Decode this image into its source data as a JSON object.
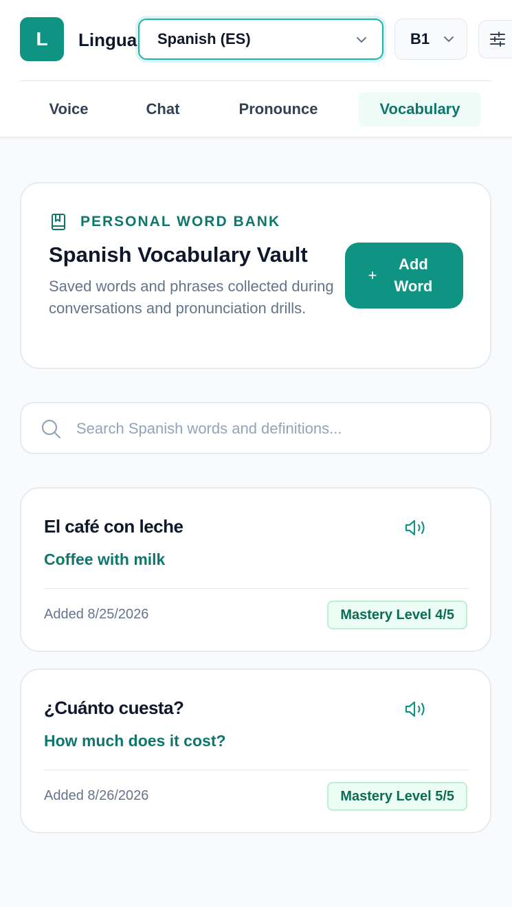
{
  "app": {
    "logo_letter": "L",
    "brand": "Lingua"
  },
  "language_select": {
    "value": "Spanish (ES)"
  },
  "level_select": {
    "value": "B1"
  },
  "tabs": [
    {
      "label": "Voice"
    },
    {
      "label": "Chat"
    },
    {
      "label": "Pronounce"
    },
    {
      "label": "Vocabulary",
      "active": true
    }
  ],
  "hero": {
    "eyebrow": "PERSONAL WORD BANK",
    "title": "Spanish Vocabulary Vault",
    "description": "Saved words and phrases collected during conversations and pronunciation drills.",
    "add_button": "Add Word"
  },
  "search": {
    "placeholder": "Search Spanish words and definitions...",
    "value": ""
  },
  "words": [
    {
      "term": "El café con leche",
      "translation": "Coffee with milk",
      "added": "Added 8/25/2026",
      "mastery": "Mastery Level 4/5"
    },
    {
      "term": "¿Cuánto cuesta?",
      "translation": "How much does it cost?",
      "added": "Added 8/26/2026",
      "mastery": "Mastery Level 5/5"
    }
  ],
  "colors": {
    "accent": "#0f9484",
    "accent_text": "#0f766e",
    "badge_bg": "#ecfdf5",
    "badge_border": "#bbf0d5"
  },
  "icons": {
    "settings": "sliders-icon",
    "bookmark": "bookmark-book-icon",
    "search": "search-icon",
    "speaker": "speaker-icon",
    "chevron": "chevron-down-icon"
  }
}
